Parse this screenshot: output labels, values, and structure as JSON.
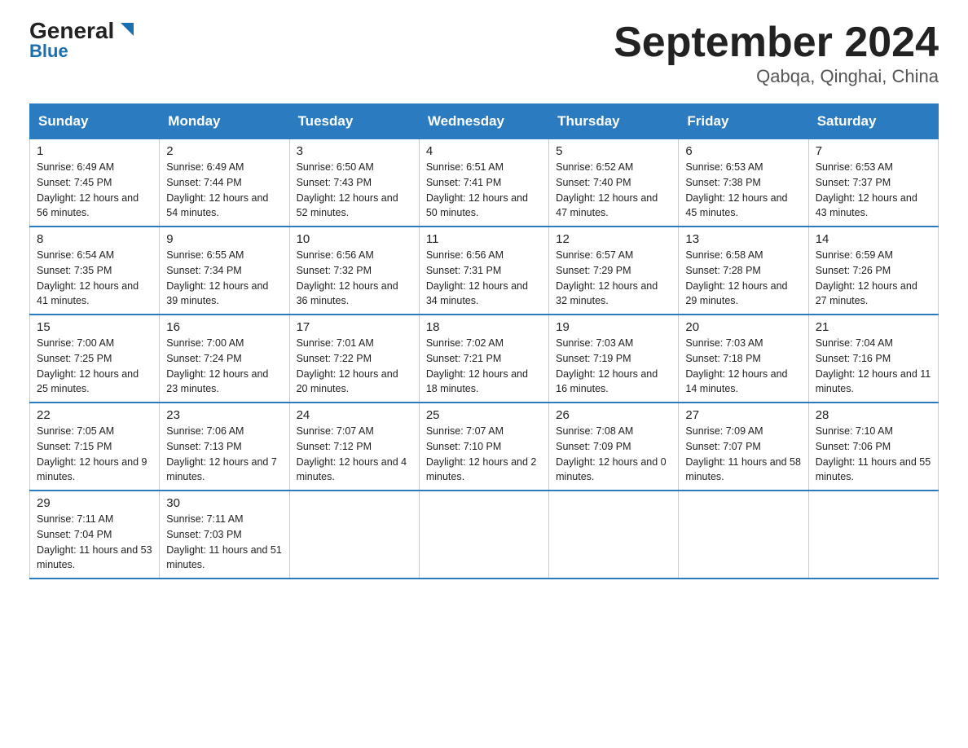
{
  "header": {
    "logo_line1": "General",
    "logo_line2": "Blue",
    "month_title": "September 2024",
    "location": "Qabqa, Qinghai, China"
  },
  "days_of_week": [
    "Sunday",
    "Monday",
    "Tuesday",
    "Wednesday",
    "Thursday",
    "Friday",
    "Saturday"
  ],
  "weeks": [
    [
      {
        "day": 1,
        "sunrise": "6:49 AM",
        "sunset": "7:45 PM",
        "daylight": "12 hours and 56 minutes."
      },
      {
        "day": 2,
        "sunrise": "6:49 AM",
        "sunset": "7:44 PM",
        "daylight": "12 hours and 54 minutes."
      },
      {
        "day": 3,
        "sunrise": "6:50 AM",
        "sunset": "7:43 PM",
        "daylight": "12 hours and 52 minutes."
      },
      {
        "day": 4,
        "sunrise": "6:51 AM",
        "sunset": "7:41 PM",
        "daylight": "12 hours and 50 minutes."
      },
      {
        "day": 5,
        "sunrise": "6:52 AM",
        "sunset": "7:40 PM",
        "daylight": "12 hours and 47 minutes."
      },
      {
        "day": 6,
        "sunrise": "6:53 AM",
        "sunset": "7:38 PM",
        "daylight": "12 hours and 45 minutes."
      },
      {
        "day": 7,
        "sunrise": "6:53 AM",
        "sunset": "7:37 PM",
        "daylight": "12 hours and 43 minutes."
      }
    ],
    [
      {
        "day": 8,
        "sunrise": "6:54 AM",
        "sunset": "7:35 PM",
        "daylight": "12 hours and 41 minutes."
      },
      {
        "day": 9,
        "sunrise": "6:55 AM",
        "sunset": "7:34 PM",
        "daylight": "12 hours and 39 minutes."
      },
      {
        "day": 10,
        "sunrise": "6:56 AM",
        "sunset": "7:32 PM",
        "daylight": "12 hours and 36 minutes."
      },
      {
        "day": 11,
        "sunrise": "6:56 AM",
        "sunset": "7:31 PM",
        "daylight": "12 hours and 34 minutes."
      },
      {
        "day": 12,
        "sunrise": "6:57 AM",
        "sunset": "7:29 PM",
        "daylight": "12 hours and 32 minutes."
      },
      {
        "day": 13,
        "sunrise": "6:58 AM",
        "sunset": "7:28 PM",
        "daylight": "12 hours and 29 minutes."
      },
      {
        "day": 14,
        "sunrise": "6:59 AM",
        "sunset": "7:26 PM",
        "daylight": "12 hours and 27 minutes."
      }
    ],
    [
      {
        "day": 15,
        "sunrise": "7:00 AM",
        "sunset": "7:25 PM",
        "daylight": "12 hours and 25 minutes."
      },
      {
        "day": 16,
        "sunrise": "7:00 AM",
        "sunset": "7:24 PM",
        "daylight": "12 hours and 23 minutes."
      },
      {
        "day": 17,
        "sunrise": "7:01 AM",
        "sunset": "7:22 PM",
        "daylight": "12 hours and 20 minutes."
      },
      {
        "day": 18,
        "sunrise": "7:02 AM",
        "sunset": "7:21 PM",
        "daylight": "12 hours and 18 minutes."
      },
      {
        "day": 19,
        "sunrise": "7:03 AM",
        "sunset": "7:19 PM",
        "daylight": "12 hours and 16 minutes."
      },
      {
        "day": 20,
        "sunrise": "7:03 AM",
        "sunset": "7:18 PM",
        "daylight": "12 hours and 14 minutes."
      },
      {
        "day": 21,
        "sunrise": "7:04 AM",
        "sunset": "7:16 PM",
        "daylight": "12 hours and 11 minutes."
      }
    ],
    [
      {
        "day": 22,
        "sunrise": "7:05 AM",
        "sunset": "7:15 PM",
        "daylight": "12 hours and 9 minutes."
      },
      {
        "day": 23,
        "sunrise": "7:06 AM",
        "sunset": "7:13 PM",
        "daylight": "12 hours and 7 minutes."
      },
      {
        "day": 24,
        "sunrise": "7:07 AM",
        "sunset": "7:12 PM",
        "daylight": "12 hours and 4 minutes."
      },
      {
        "day": 25,
        "sunrise": "7:07 AM",
        "sunset": "7:10 PM",
        "daylight": "12 hours and 2 minutes."
      },
      {
        "day": 26,
        "sunrise": "7:08 AM",
        "sunset": "7:09 PM",
        "daylight": "12 hours and 0 minutes."
      },
      {
        "day": 27,
        "sunrise": "7:09 AM",
        "sunset": "7:07 PM",
        "daylight": "11 hours and 58 minutes."
      },
      {
        "day": 28,
        "sunrise": "7:10 AM",
        "sunset": "7:06 PM",
        "daylight": "11 hours and 55 minutes."
      }
    ],
    [
      {
        "day": 29,
        "sunrise": "7:11 AM",
        "sunset": "7:04 PM",
        "daylight": "11 hours and 53 minutes."
      },
      {
        "day": 30,
        "sunrise": "7:11 AM",
        "sunset": "7:03 PM",
        "daylight": "11 hours and 51 minutes."
      },
      null,
      null,
      null,
      null,
      null
    ]
  ]
}
